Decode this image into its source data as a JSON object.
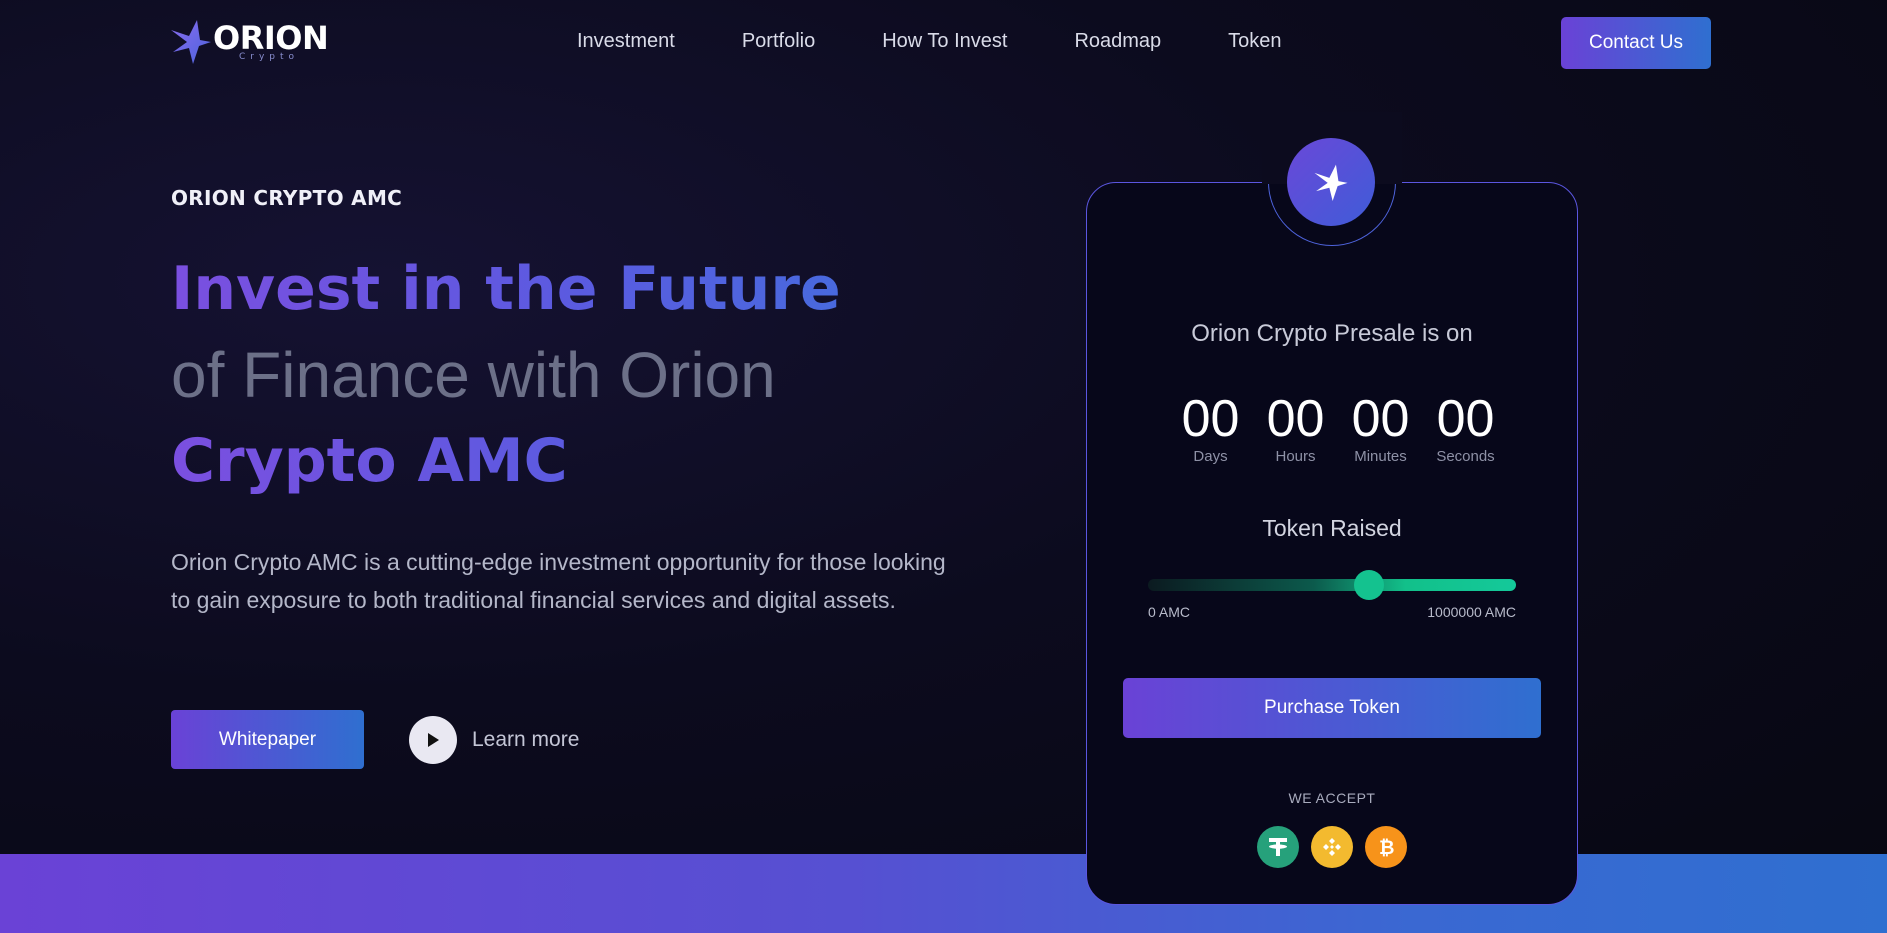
{
  "nav": {
    "logo_word": "ORION",
    "logo_sub": "Crypto",
    "links": [
      "Investment",
      "Portfolio",
      "How To Invest",
      "Roadmap",
      "Token"
    ],
    "contact_label": "Contact Us"
  },
  "hero": {
    "eyebrow": "ORION CRYPTO AMC",
    "headline_line1": "Invest in the Future",
    "headline_line2": "of Finance with Orion",
    "headline_line3": "Crypto AMC",
    "description": "Orion Crypto AMC is a cutting-edge investment opportunity for those looking to gain exposure to both traditional financial services and digital assets.",
    "whitepaper_label": "Whitepaper",
    "learn_more_label": "Learn more"
  },
  "presale": {
    "title": "Orion Crypto Presale is on",
    "countdown": [
      {
        "value": "00",
        "label": "Days"
      },
      {
        "value": "00",
        "label": "Hours"
      },
      {
        "value": "00",
        "label": "Minutes"
      },
      {
        "value": "00",
        "label": "Seconds"
      }
    ],
    "raised_title": "Token Raised",
    "raised_fraction": 0.6,
    "range_min": "0 AMC",
    "range_max": "1000000 AMC",
    "purchase_label": "Purchase Token",
    "accept_label": "WE ACCEPT",
    "accepted_coins": [
      "tether-icon",
      "bnb-icon",
      "bitcoin-icon"
    ]
  },
  "colors": {
    "accent_start": "#6a42d6",
    "accent_end": "#2f6fd0",
    "progress": "#14c28f",
    "background": "#0c0b1e"
  }
}
